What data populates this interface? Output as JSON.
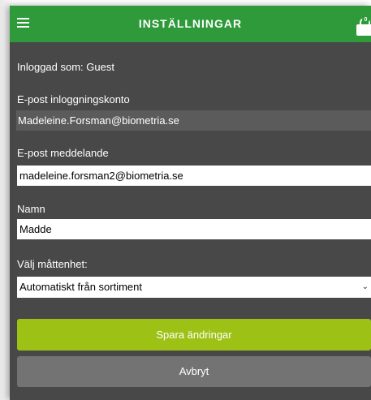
{
  "header": {
    "title": "INSTÄLLNINGAR",
    "menu_icon": "hamburger-icon",
    "cart_icon": "shopping-bag-icon",
    "cart_count": "0",
    "color": "#2e9a3a"
  },
  "form": {
    "logged_in_label": "Inloggad som: Guest",
    "login_email_label": "E-post inloggningskonto",
    "login_email_value": "Madeleine.Forsman@biometria.se",
    "notify_email_label": "E-post meddelande",
    "notify_email_value": "madeleine.forsman2@biometria.se",
    "name_label": "Namn",
    "name_value": "Madde",
    "unit_label": "Välj måttenhet:",
    "unit_selected": "Automatiskt från sortiment"
  },
  "actions": {
    "save_label": "Spara ändringar",
    "save_color": "#9ec115",
    "cancel_label": "Avbryt",
    "cancel_color": "#737373"
  }
}
